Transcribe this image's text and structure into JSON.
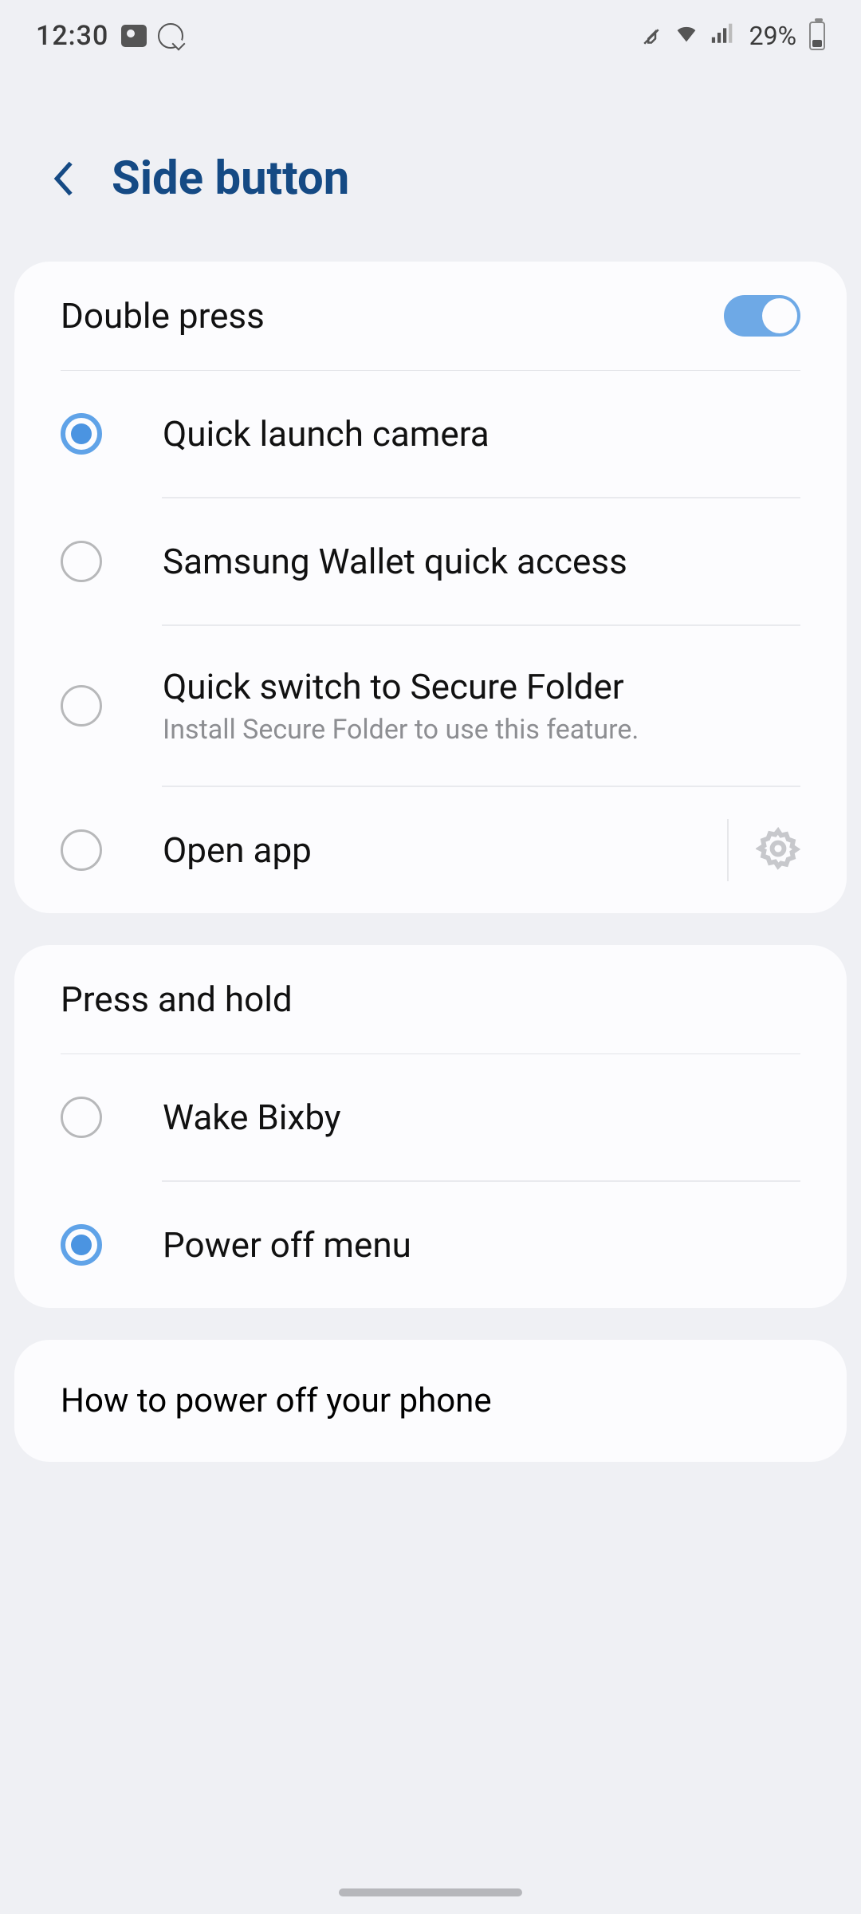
{
  "status": {
    "time": "12:30",
    "battery_pct": "29%"
  },
  "header": {
    "title": "Side button"
  },
  "double_press": {
    "header": "Double press",
    "toggle_on": true,
    "options": [
      {
        "label": "Quick launch camera",
        "selected": true
      },
      {
        "label": "Samsung Wallet quick access",
        "selected": false
      },
      {
        "label": "Quick switch to Secure Folder",
        "sublabel": "Install Secure Folder to use this feature.",
        "selected": false
      },
      {
        "label": "Open app",
        "selected": false,
        "has_gear": true
      }
    ]
  },
  "press_hold": {
    "header": "Press and hold",
    "options": [
      {
        "label": "Wake Bixby",
        "selected": false
      },
      {
        "label": "Power off menu",
        "selected": true
      }
    ]
  },
  "help": {
    "label": "How to power off your phone"
  }
}
